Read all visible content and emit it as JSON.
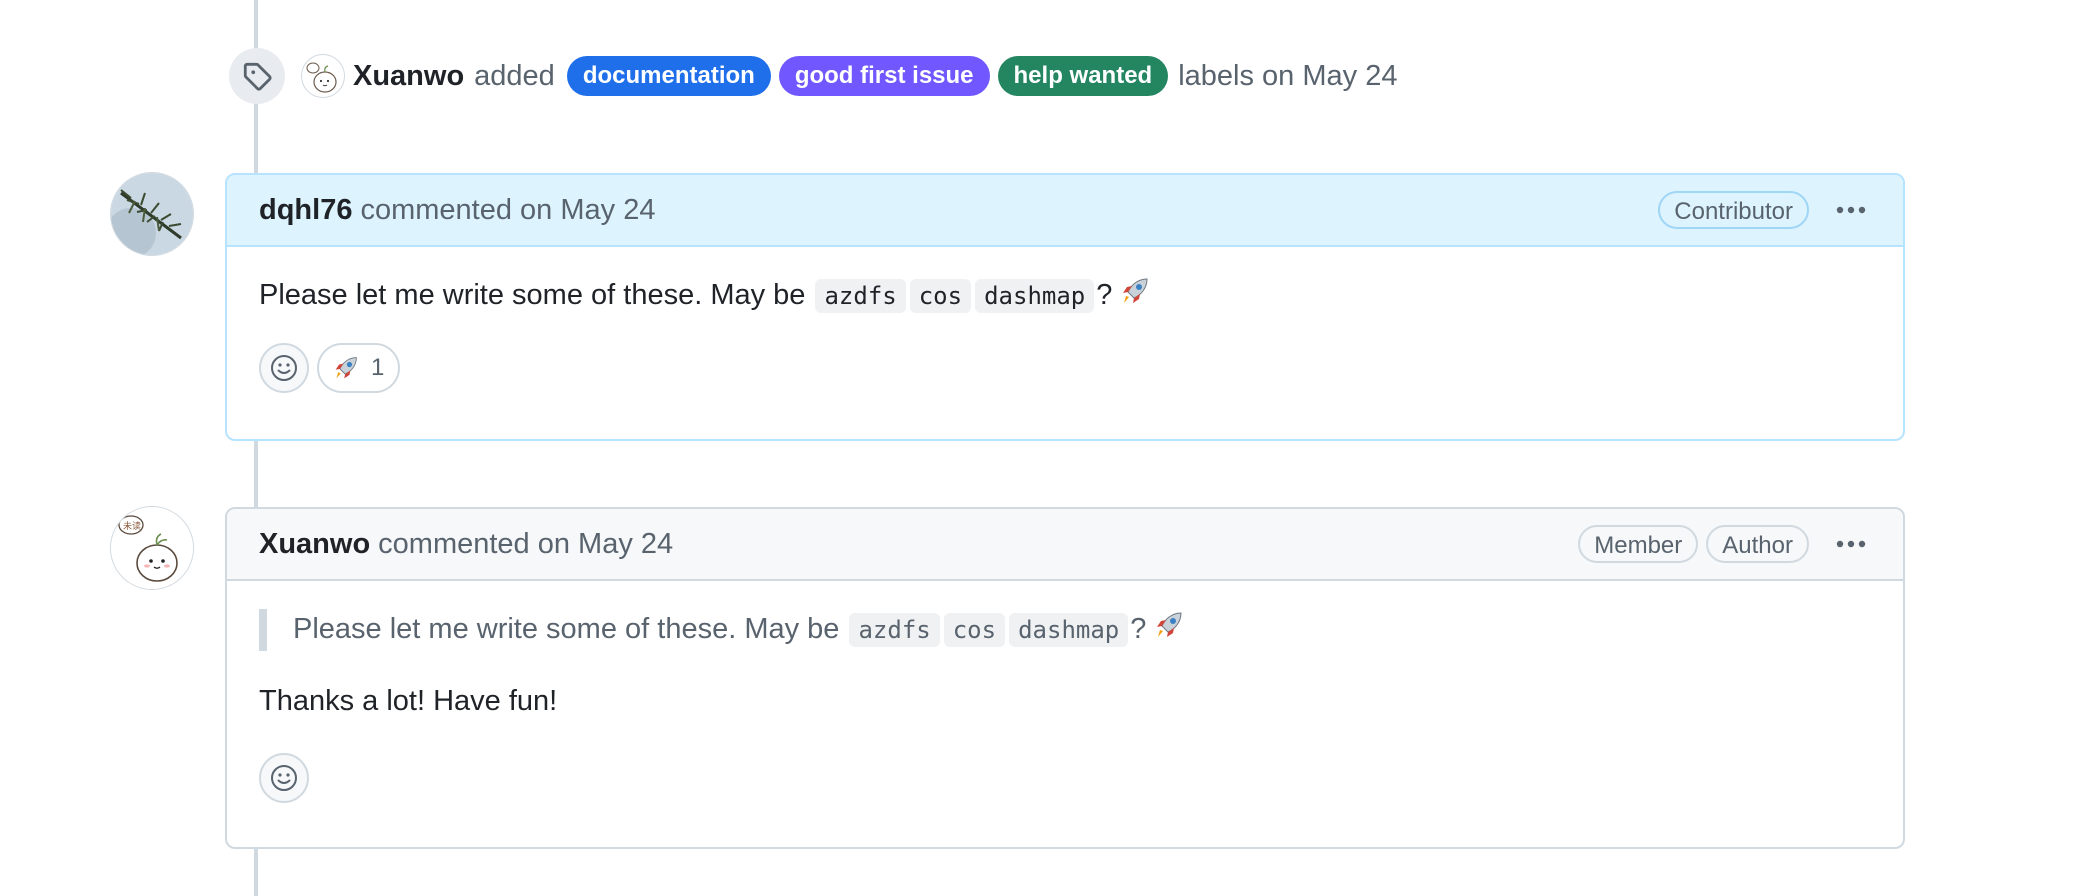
{
  "label_event": {
    "actor": "Xuanwo",
    "verb": "added",
    "labels": [
      {
        "name": "documentation",
        "color": "#1f6feb"
      },
      {
        "name": "good first issue",
        "color": "#7057ff"
      },
      {
        "name": "help wanted",
        "color": "#238661"
      }
    ],
    "suffix": "labels on May 24",
    "icon": "tag-icon"
  },
  "comments": [
    {
      "author": "dqhl76",
      "meta": "commented on May 24",
      "roles": [
        "Contributor"
      ],
      "avatar_icon": "pine-branch-avatar",
      "body_text": "Please let me write some of these. May be",
      "code_items": [
        "azdfs",
        "cos",
        "dashmap"
      ],
      "body_end": "?",
      "reactions": [
        {
          "emoji": "rocket",
          "count": "1"
        }
      ]
    },
    {
      "author": "Xuanwo",
      "meta": "commented on May 24",
      "roles": [
        "Member",
        "Author"
      ],
      "avatar_icon": "cartoon-bun-avatar",
      "quote_text": "Please let me write some of these. May be",
      "quote_code_items": [
        "azdfs",
        "cos",
        "dashmap"
      ],
      "quote_end": "?",
      "reply": "Thanks a lot! Have fun!",
      "reactions": []
    }
  ],
  "colors": {
    "timeline": "#d1d9e0",
    "highlight_header": "#ddf4ff",
    "highlight_border": "#b6e3ff",
    "default_header": "#f6f8fa",
    "default_border": "#d1d9e0"
  }
}
